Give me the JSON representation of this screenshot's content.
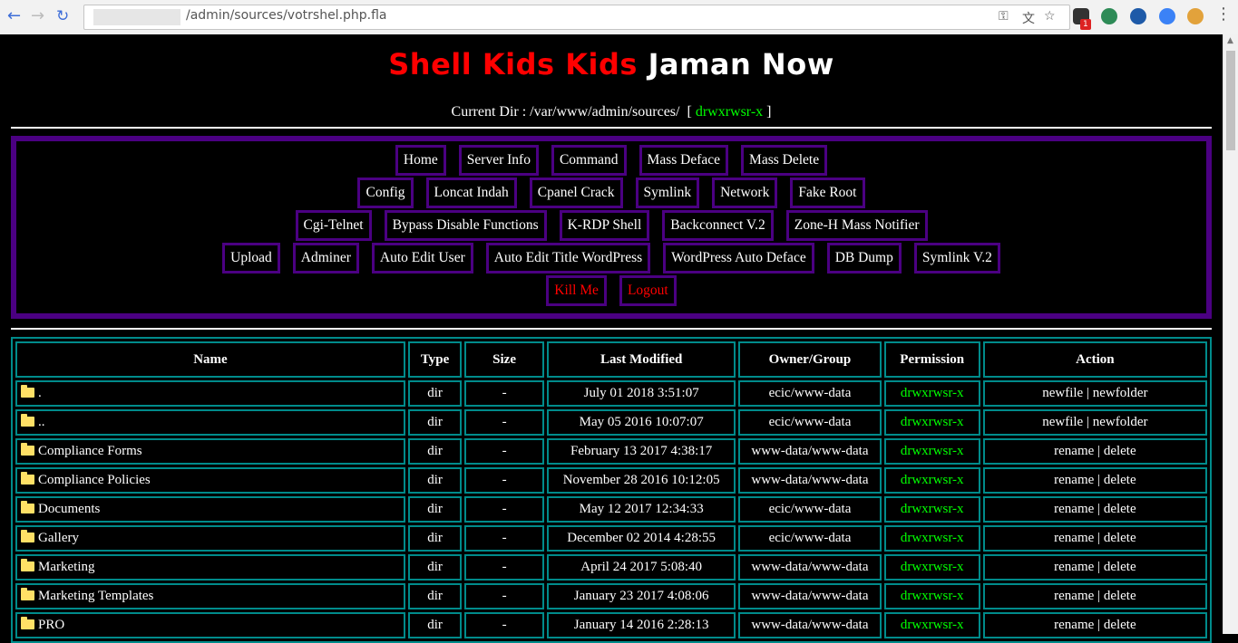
{
  "browser": {
    "url": "/admin/sources/votrshel.php.fla",
    "nav": {
      "back": "←",
      "forward": "→",
      "reload": "↻"
    },
    "omnibox_icons": [
      "key-icon",
      "translate-icon",
      "star-icon"
    ],
    "extension_badge": "1"
  },
  "header": {
    "title_red": "Shell Kids Kids",
    "title_white": "Jaman Now",
    "current_dir_label": "Current Dir : /var/www/admin/sources/",
    "dir_perm_open": "[",
    "dir_perm": "drwxrwsr-x",
    "dir_perm_close": "]"
  },
  "menu": {
    "row1": [
      "Home",
      "Server Info",
      "Command",
      "Mass Deface",
      "Mass Delete"
    ],
    "row2": [
      "Config",
      "Loncat Indah",
      "Cpanel Crack",
      "Symlink",
      "Network",
      "Fake Root"
    ],
    "row3": [
      "Cgi-Telnet",
      "Bypass Disable Functions",
      "K-RDP Shell",
      "Backconnect V.2",
      "Zone-H Mass Notifier"
    ],
    "row4": [
      "Upload",
      "Adminer",
      "Auto Edit User",
      "Auto Edit Title WordPress",
      "WordPress Auto Deface",
      "DB Dump",
      "Symlink V.2"
    ],
    "row5": [
      "Kill Me",
      "Logout"
    ]
  },
  "table": {
    "headers": [
      "Name",
      "Type",
      "Size",
      "Last Modified",
      "Owner/Group",
      "Permission",
      "Action"
    ],
    "rows": [
      {
        "name": ".",
        "type": "dir",
        "size": "-",
        "modified": "July 01 2018 3:51:07",
        "owner": "ecic/www-data",
        "perm": "drwxrwsr-x",
        "action_a": "newfile",
        "sep": "|",
        "action_b": "newfolder"
      },
      {
        "name": "..",
        "type": "dir",
        "size": "-",
        "modified": "May 05 2016 10:07:07",
        "owner": "ecic/www-data",
        "perm": "drwxrwsr-x",
        "action_a": "newfile",
        "sep": "|",
        "action_b": "newfolder"
      },
      {
        "name": "Compliance Forms",
        "type": "dir",
        "size": "-",
        "modified": "February 13 2017 4:38:17",
        "owner": "www-data/www-data",
        "perm": "drwxrwsr-x",
        "action_a": "rename",
        "sep": "|",
        "action_b": "delete"
      },
      {
        "name": "Compliance Policies",
        "type": "dir",
        "size": "-",
        "modified": "November 28 2016 10:12:05",
        "owner": "www-data/www-data",
        "perm": "drwxrwsr-x",
        "action_a": "rename",
        "sep": "|",
        "action_b": "delete"
      },
      {
        "name": "Documents",
        "type": "dir",
        "size": "-",
        "modified": "May 12 2017 12:34:33",
        "owner": "ecic/www-data",
        "perm": "drwxrwsr-x",
        "action_a": "rename",
        "sep": "|",
        "action_b": "delete"
      },
      {
        "name": "Gallery",
        "type": "dir",
        "size": "-",
        "modified": "December 02 2014 4:28:55",
        "owner": "ecic/www-data",
        "perm": "drwxrwsr-x",
        "action_a": "rename",
        "sep": "|",
        "action_b": "delete"
      },
      {
        "name": "Marketing",
        "type": "dir",
        "size": "-",
        "modified": "April 24 2017 5:08:40",
        "owner": "www-data/www-data",
        "perm": "drwxrwsr-x",
        "action_a": "rename",
        "sep": "|",
        "action_b": "delete"
      },
      {
        "name": "Marketing Templates",
        "type": "dir",
        "size": "-",
        "modified": "January 23 2017 4:08:06",
        "owner": "www-data/www-data",
        "perm": "drwxrwsr-x",
        "action_a": "rename",
        "sep": "|",
        "action_b": "delete"
      },
      {
        "name": "PRO",
        "type": "dir",
        "size": "-",
        "modified": "January 14 2016 2:28:13",
        "owner": "www-data/www-data",
        "perm": "drwxrwsr-x",
        "action_a": "rename",
        "sep": "|",
        "action_b": "delete"
      }
    ]
  },
  "colors": {
    "title_red": "#ff0000",
    "perm_green": "#00ff00",
    "menu_border": "#4b0082",
    "table_border": "#008b8b",
    "folder": "#ffe066"
  }
}
